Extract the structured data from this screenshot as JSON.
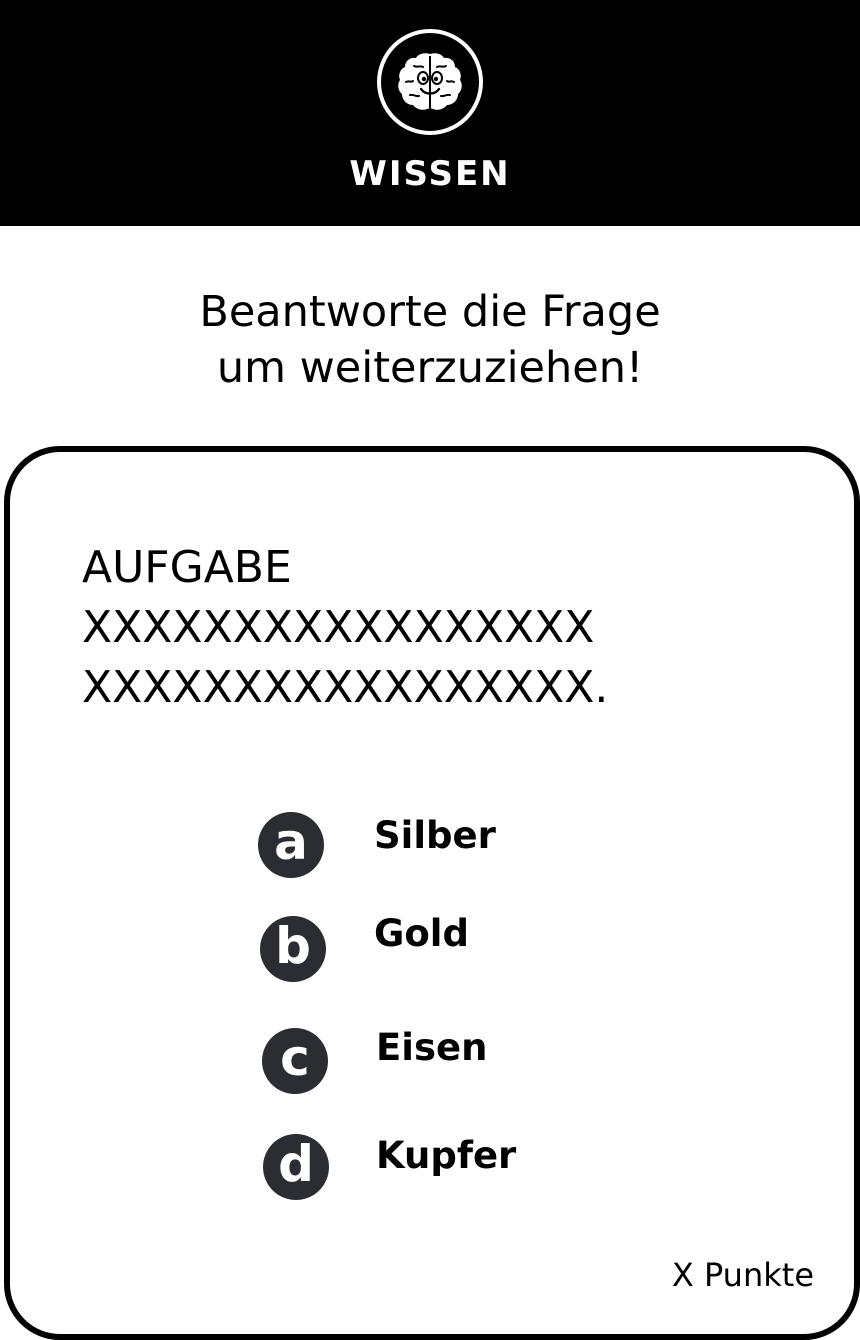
{
  "header": {
    "logo_icon": "brain-mascot-icon",
    "category": "WISSEN",
    "background_color": "#000000",
    "text_color": "#ffffff"
  },
  "instruction": {
    "line1": "Beantworte die Frage",
    "line2": "um weiterzuziehen!"
  },
  "card": {
    "task_title": "AUFGABE",
    "task_line1": "XXXXXXXXXXXXXXXXX",
    "task_line2": "XXXXXXXXXXXXXXXXX.",
    "answers": [
      {
        "key": "a",
        "label": "Silber"
      },
      {
        "key": "b",
        "label": "Gold"
      },
      {
        "key": "c",
        "label": "Eisen"
      },
      {
        "key": "d",
        "label": "Kupfer"
      }
    ],
    "points": "X Punkte",
    "badge_color": "#2b2d33"
  }
}
